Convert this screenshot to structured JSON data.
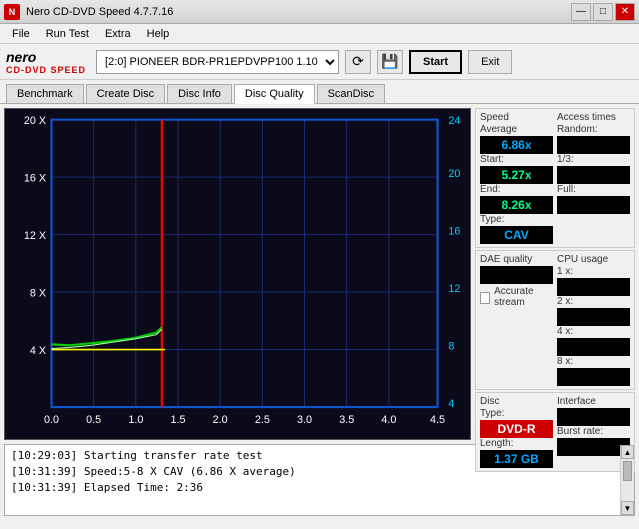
{
  "window": {
    "title": "Nero CD-DVD Speed 4.7.7.16",
    "min_btn": "—",
    "max_btn": "□",
    "close_btn": "✕"
  },
  "menu": {
    "items": [
      "File",
      "Run Test",
      "Extra",
      "Help"
    ]
  },
  "toolbar": {
    "drive_label": "[2:0]  PIONEER BDR-PR1EPDVPP100 1.10",
    "start_label": "Start",
    "exit_label": "Exit"
  },
  "tabs": {
    "items": [
      "Benchmark",
      "Create Disc",
      "Disc Info",
      "Disc Quality",
      "ScanDisc"
    ],
    "active": "Disc Quality"
  },
  "graph": {
    "y_labels_left": [
      "20 X",
      "16 X",
      "12 X",
      "8 X",
      "4 X"
    ],
    "y_labels_right": [
      "24",
      "20",
      "16",
      "12",
      "8",
      "4"
    ],
    "x_labels": [
      "0.0",
      "0.5",
      "1.0",
      "1.5",
      "2.0",
      "2.5",
      "3.0",
      "3.5",
      "4.0",
      "4.5"
    ]
  },
  "right_panel": {
    "speed": {
      "label": "Speed",
      "average_label": "Average",
      "average_value": "6.86x",
      "start_label": "Start:",
      "start_value": "5.27x",
      "end_label": "End:",
      "end_value": "8.26x",
      "type_label": "Type:",
      "type_value": "CAV"
    },
    "access_times": {
      "label": "Access times",
      "random_label": "Random:",
      "random_value": "",
      "onethird_label": "1/3:",
      "onethird_value": "",
      "full_label": "Full:",
      "full_value": ""
    },
    "cpu": {
      "label": "CPU usage",
      "1x_label": "1 x:",
      "1x_value": "",
      "2x_label": "2 x:",
      "2x_value": "",
      "4x_label": "4 x:",
      "4x_value": "",
      "8x_label": "8 x:",
      "8x_value": ""
    },
    "dae": {
      "label": "DAE quality",
      "value": "",
      "accurate_label": "Accurate stream"
    },
    "disc": {
      "label": "Disc",
      "type_label": "Type:",
      "type_value": "DVD-R",
      "length_label": "Length:",
      "length_value": "1.37 GB"
    },
    "interface": {
      "label": "Interface",
      "burst_label": "Burst rate:",
      "burst_value": ""
    }
  },
  "log": {
    "lines": [
      "[10:29:03]  Starting transfer rate test",
      "[10:31:39]  Speed:5-8 X CAV (6.86 X average)",
      "[10:31:39]  Elapsed Time: 2:36"
    ]
  }
}
